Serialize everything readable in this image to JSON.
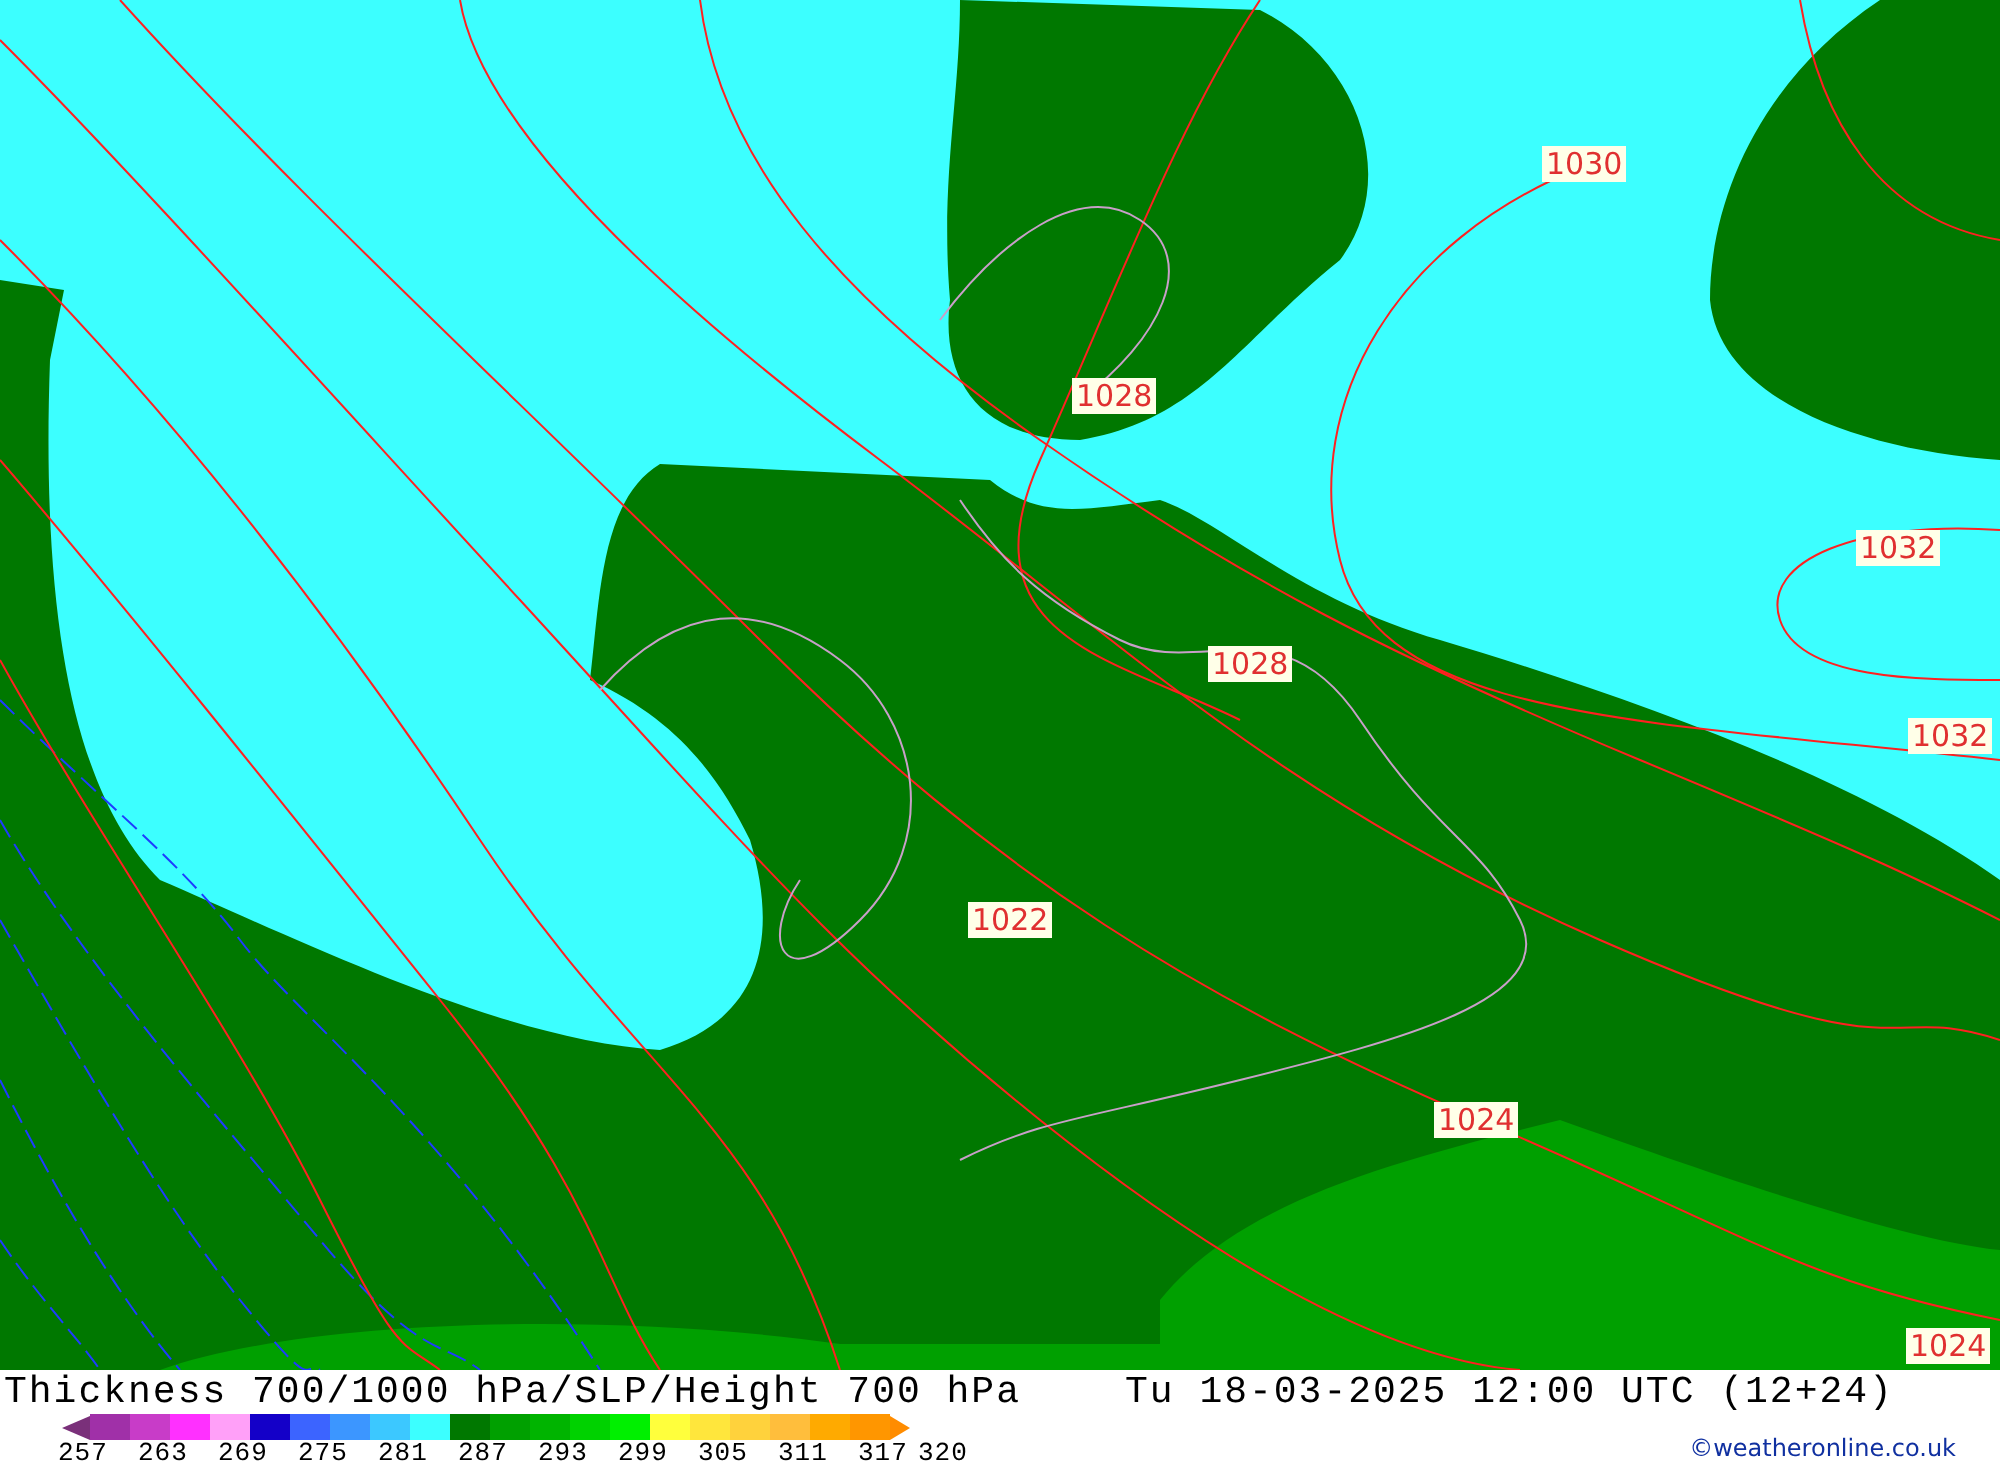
{
  "map": {
    "isobar_labels": [
      {
        "text": "1030"
      },
      {
        "text": "1028"
      },
      {
        "text": "1032"
      },
      {
        "text": "1028"
      },
      {
        "text": "1032"
      },
      {
        "text": "1022"
      },
      {
        "text": "1024"
      },
      {
        "text": "1024"
      }
    ]
  },
  "title": "Thickness 700/1000 hPa/SLP/Height 700 hPa",
  "valid_time": "Tu 18-03-2025 12:00 UTC (12+24)",
  "legend": {
    "swatches": [
      {
        "kind": "arrow-left",
        "color": "#7a307a"
      },
      {
        "kind": "box",
        "color": "#a030a8"
      },
      {
        "kind": "box",
        "color": "#c83cc8"
      },
      {
        "kind": "box",
        "color": "#ff30ff"
      },
      {
        "kind": "box",
        "color": "#ffa0f8"
      },
      {
        "kind": "box",
        "color": "#1400c8"
      },
      {
        "kind": "box",
        "color": "#3c64ff"
      },
      {
        "kind": "box",
        "color": "#3c96ff"
      },
      {
        "kind": "box",
        "color": "#3cc8ff"
      },
      {
        "kind": "box",
        "color": "#3cffff"
      },
      {
        "kind": "box",
        "color": "#007800"
      },
      {
        "kind": "box",
        "color": "#00a000"
      },
      {
        "kind": "box",
        "color": "#00b400"
      },
      {
        "kind": "box",
        "color": "#00d200"
      },
      {
        "kind": "box",
        "color": "#00f000"
      },
      {
        "kind": "box",
        "color": "#ffff3c"
      },
      {
        "kind": "box",
        "color": "#ffe63c"
      },
      {
        "kind": "box",
        "color": "#ffd23c"
      },
      {
        "kind": "box",
        "color": "#ffbe3c"
      },
      {
        "kind": "box",
        "color": "#ffaa00"
      },
      {
        "kind": "box",
        "color": "#ff9600"
      },
      {
        "kind": "arrow-right",
        "color": "#ff8c00"
      }
    ],
    "labels": [
      "257",
      "263",
      "269",
      "275",
      "281",
      "287",
      "293",
      "299",
      "305",
      "311",
      "317",
      "320"
    ]
  },
  "credit": "©weatheronline.co.uk"
}
